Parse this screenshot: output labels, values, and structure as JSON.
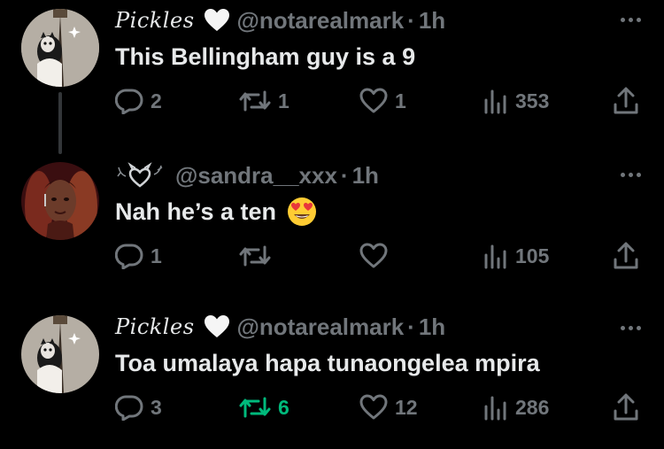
{
  "tweets": [
    {
      "name": "Pickles",
      "handle": "@notarealmark",
      "dot": "·",
      "time": "1h",
      "text": "This Bellingham guy is a 9",
      "replies": "2",
      "reposts": "1",
      "likes": "1",
      "views": "353",
      "reposted": false
    },
    {
      "name": "",
      "handle": "@sandra__xxx",
      "dot": "·",
      "time": "1h",
      "text": "Nah he’s a ten",
      "replies": "1",
      "reposts": "",
      "likes": "",
      "views": "105",
      "reposted": false
    },
    {
      "name": "Pickles",
      "handle": "@notarealmark",
      "dot": "·",
      "time": "1h",
      "text": "Toa umalaya hapa tunaongelea mpira",
      "replies": "3",
      "reposts": "6",
      "likes": "12",
      "views": "286",
      "reposted": true
    }
  ],
  "colors": {
    "background": "#000000",
    "text": "#e7e9ea",
    "muted": "#71767b",
    "repost_active": "#00ba7c",
    "thread_line": "#333639"
  },
  "icons": [
    "reply-icon",
    "repost-icon",
    "like-icon",
    "views-icon",
    "share-icon",
    "more-icon",
    "white-heart-icon",
    "heart-eyes-emoji",
    "devil-heart-icon"
  ]
}
